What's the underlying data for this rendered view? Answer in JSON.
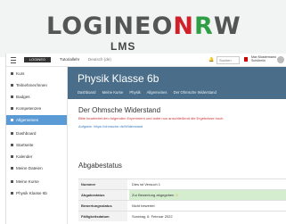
{
  "brand": {
    "logo_left": "LOGINEO",
    "logo_right": "NRW",
    "subtitle": "LMS",
    "colors": {
      "logineo": "#555555",
      "n": "#d0202a",
      "r": "#2f9e44",
      "w": "#555555"
    }
  },
  "topbar": {
    "site_label": "LOGINEO NRW",
    "nav_item": "Tutoriallehr",
    "nav_item2": "Deutsch (de)",
    "search_placeholder": "Suchen",
    "user_name": "Max Mustermann",
    "user_role": "Schüler/in"
  },
  "sidebar": {
    "items": [
      {
        "label": "Kurs"
      },
      {
        "label": "Teilnehmer/innen"
      },
      {
        "label": "Badges"
      },
      {
        "label": "Kompetenzen"
      },
      {
        "label": "Allgemeines"
      },
      {
        "label": "Dashboard"
      },
      {
        "label": "Startseite"
      },
      {
        "label": "Kalender"
      },
      {
        "label": "Meine Dateien"
      },
      {
        "label": "Meine Kurse"
      },
      {
        "label": "Physik Klasse 6b"
      }
    ],
    "active_index": 4
  },
  "header": {
    "title": "Physik Klasse 6b",
    "breadcrumbs": [
      "Dashboard",
      "Meine Kurse",
      "Physik",
      "Allgemeines",
      "Der Ohmsche Widerstand"
    ]
  },
  "assignment": {
    "title": "Der Ohmsche Widerstand",
    "description": "Bitte bearbeitet den folgenden Experiment und ladet nun anschließend die Ergebnisse hoch.",
    "link": "Aufgabe: https://ohmsche.de/Widerstand"
  },
  "status": {
    "title": "Abgabestatus",
    "rows": [
      {
        "key": "Nummer",
        "value": "Dies ist Versuch 1"
      },
      {
        "key": "Abgabestatus",
        "value": "Zur Bewertung abgegeben",
        "highlight": true
      },
      {
        "key": "Bewertungsstatus",
        "value": "Nicht bewertet"
      },
      {
        "key": "Fälligkeitsdatum",
        "value": "Sonntag, 6. Februar 2022"
      }
    ]
  }
}
